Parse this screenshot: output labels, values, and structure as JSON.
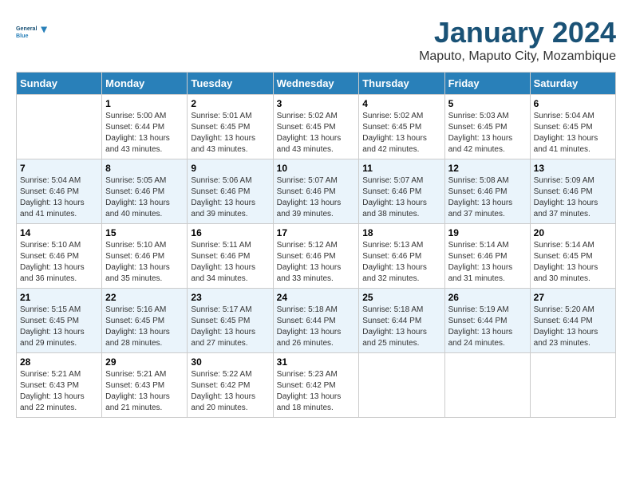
{
  "header": {
    "logo_line1": "General",
    "logo_line2": "Blue",
    "title": "January 2024",
    "subtitle": "Maputo, Maputo City, Mozambique"
  },
  "weekdays": [
    "Sunday",
    "Monday",
    "Tuesday",
    "Wednesday",
    "Thursday",
    "Friday",
    "Saturday"
  ],
  "weeks": [
    [
      {
        "day": "",
        "sunrise": "",
        "sunset": "",
        "daylight": ""
      },
      {
        "day": "1",
        "sunrise": "5:00 AM",
        "sunset": "6:44 PM",
        "daylight": "13 hours and 43 minutes."
      },
      {
        "day": "2",
        "sunrise": "5:01 AM",
        "sunset": "6:45 PM",
        "daylight": "13 hours and 43 minutes."
      },
      {
        "day": "3",
        "sunrise": "5:02 AM",
        "sunset": "6:45 PM",
        "daylight": "13 hours and 43 minutes."
      },
      {
        "day": "4",
        "sunrise": "5:02 AM",
        "sunset": "6:45 PM",
        "daylight": "13 hours and 42 minutes."
      },
      {
        "day": "5",
        "sunrise": "5:03 AM",
        "sunset": "6:45 PM",
        "daylight": "13 hours and 42 minutes."
      },
      {
        "day": "6",
        "sunrise": "5:04 AM",
        "sunset": "6:45 PM",
        "daylight": "13 hours and 41 minutes."
      }
    ],
    [
      {
        "day": "7",
        "sunrise": "5:04 AM",
        "sunset": "6:46 PM",
        "daylight": "13 hours and 41 minutes."
      },
      {
        "day": "8",
        "sunrise": "5:05 AM",
        "sunset": "6:46 PM",
        "daylight": "13 hours and 40 minutes."
      },
      {
        "day": "9",
        "sunrise": "5:06 AM",
        "sunset": "6:46 PM",
        "daylight": "13 hours and 39 minutes."
      },
      {
        "day": "10",
        "sunrise": "5:07 AM",
        "sunset": "6:46 PM",
        "daylight": "13 hours and 39 minutes."
      },
      {
        "day": "11",
        "sunrise": "5:07 AM",
        "sunset": "6:46 PM",
        "daylight": "13 hours and 38 minutes."
      },
      {
        "day": "12",
        "sunrise": "5:08 AM",
        "sunset": "6:46 PM",
        "daylight": "13 hours and 37 minutes."
      },
      {
        "day": "13",
        "sunrise": "5:09 AM",
        "sunset": "6:46 PM",
        "daylight": "13 hours and 37 minutes."
      }
    ],
    [
      {
        "day": "14",
        "sunrise": "5:10 AM",
        "sunset": "6:46 PM",
        "daylight": "13 hours and 36 minutes."
      },
      {
        "day": "15",
        "sunrise": "5:10 AM",
        "sunset": "6:46 PM",
        "daylight": "13 hours and 35 minutes."
      },
      {
        "day": "16",
        "sunrise": "5:11 AM",
        "sunset": "6:46 PM",
        "daylight": "13 hours and 34 minutes."
      },
      {
        "day": "17",
        "sunrise": "5:12 AM",
        "sunset": "6:46 PM",
        "daylight": "13 hours and 33 minutes."
      },
      {
        "day": "18",
        "sunrise": "5:13 AM",
        "sunset": "6:46 PM",
        "daylight": "13 hours and 32 minutes."
      },
      {
        "day": "19",
        "sunrise": "5:14 AM",
        "sunset": "6:46 PM",
        "daylight": "13 hours and 31 minutes."
      },
      {
        "day": "20",
        "sunrise": "5:14 AM",
        "sunset": "6:45 PM",
        "daylight": "13 hours and 30 minutes."
      }
    ],
    [
      {
        "day": "21",
        "sunrise": "5:15 AM",
        "sunset": "6:45 PM",
        "daylight": "13 hours and 29 minutes."
      },
      {
        "day": "22",
        "sunrise": "5:16 AM",
        "sunset": "6:45 PM",
        "daylight": "13 hours and 28 minutes."
      },
      {
        "day": "23",
        "sunrise": "5:17 AM",
        "sunset": "6:45 PM",
        "daylight": "13 hours and 27 minutes."
      },
      {
        "day": "24",
        "sunrise": "5:18 AM",
        "sunset": "6:44 PM",
        "daylight": "13 hours and 26 minutes."
      },
      {
        "day": "25",
        "sunrise": "5:18 AM",
        "sunset": "6:44 PM",
        "daylight": "13 hours and 25 minutes."
      },
      {
        "day": "26",
        "sunrise": "5:19 AM",
        "sunset": "6:44 PM",
        "daylight": "13 hours and 24 minutes."
      },
      {
        "day": "27",
        "sunrise": "5:20 AM",
        "sunset": "6:44 PM",
        "daylight": "13 hours and 23 minutes."
      }
    ],
    [
      {
        "day": "28",
        "sunrise": "5:21 AM",
        "sunset": "6:43 PM",
        "daylight": "13 hours and 22 minutes."
      },
      {
        "day": "29",
        "sunrise": "5:21 AM",
        "sunset": "6:43 PM",
        "daylight": "13 hours and 21 minutes."
      },
      {
        "day": "30",
        "sunrise": "5:22 AM",
        "sunset": "6:42 PM",
        "daylight": "13 hours and 20 minutes."
      },
      {
        "day": "31",
        "sunrise": "5:23 AM",
        "sunset": "6:42 PM",
        "daylight": "13 hours and 18 minutes."
      },
      {
        "day": "",
        "sunrise": "",
        "sunset": "",
        "daylight": ""
      },
      {
        "day": "",
        "sunrise": "",
        "sunset": "",
        "daylight": ""
      },
      {
        "day": "",
        "sunrise": "",
        "sunset": "",
        "daylight": ""
      }
    ]
  ]
}
